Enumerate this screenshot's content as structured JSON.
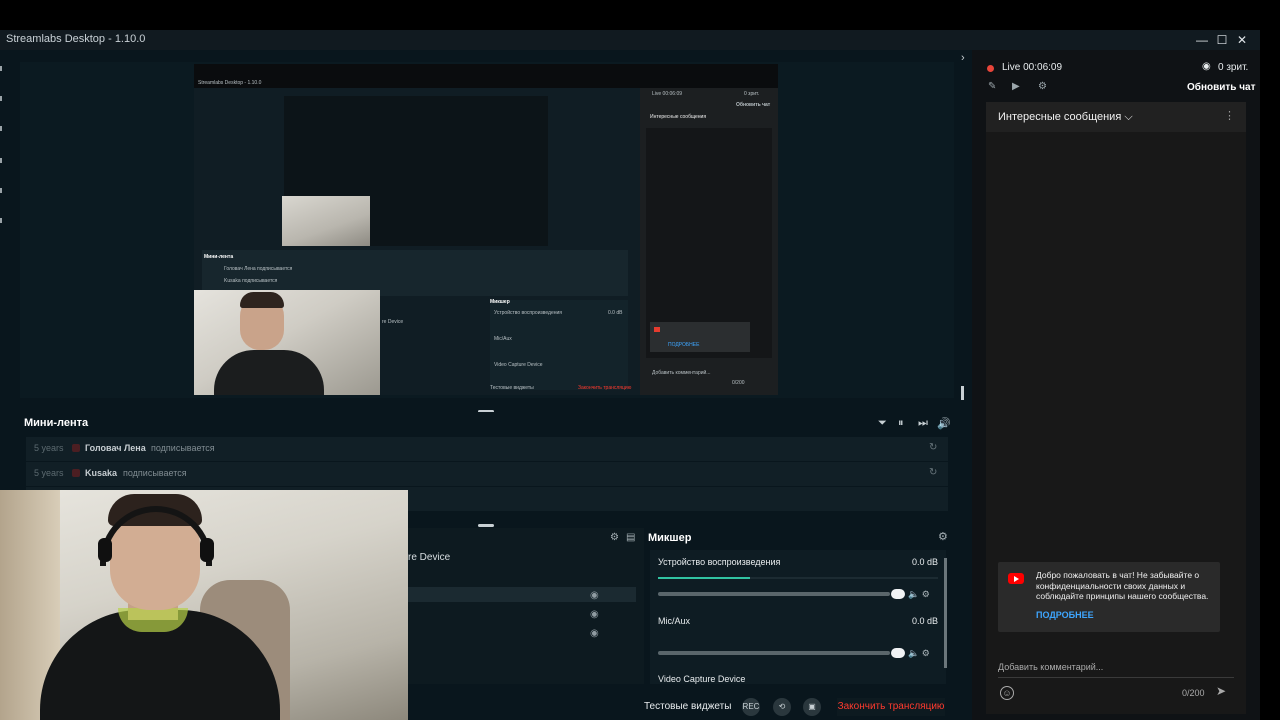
{
  "window": {
    "title": "Streamlabs Desktop - 1.10.0",
    "controls": [
      "—",
      "☐",
      "✕"
    ]
  },
  "preview": {
    "tiny_title": "Streamlabs Desktop - 1.10.0",
    "tiny_minifeed": "Мини-лента",
    "tiny_row1": "Головач Лена подписывается",
    "tiny_row2": "Kusaka подписывается",
    "tiny_mixer": "Микшер",
    "tiny_device": "Устройство воспроизведения",
    "tiny_db": "0.0 dB",
    "tiny_mic": "Mic/Aux",
    "tiny_videocap": "Video Capture Device",
    "tiny_widgets": "Тестовые виджеты",
    "tiny_end": "Закончить трансляцию",
    "tiny_chat_title": "Интересные сообщения",
    "tiny_live": "Live 00:06:09",
    "tiny_refresh": "Обновить чат",
    "tiny_add": "Добавить комментарий...",
    "tiny_count": "0/200",
    "tiny_more": "ПОДРОБНЕЕ",
    "tiny_viewers": "0 зрит.",
    "tiny_src": "re Device"
  },
  "minifeed": {
    "title": "Мини-лента",
    "controls": [
      "⏷",
      "⏸",
      "⏭",
      "🔊"
    ],
    "rows": [
      {
        "age": "5 years",
        "name": "Головач Лена",
        "action": "подписывается"
      },
      {
        "age": "5 years",
        "name": "Kusaka",
        "action": "подписывается"
      }
    ]
  },
  "sources": {
    "visible_name": "re Device",
    "icon_a": "⚙",
    "icon_b": "▤"
  },
  "mixer": {
    "title": "Микшер",
    "channels": [
      {
        "name": "Устройство воспроизведения",
        "db": "0.0 dB",
        "level": 0.33
      },
      {
        "name": "Mic/Aux",
        "db": "0.0 dB",
        "level": 0
      },
      {
        "name": "Video Capture Device",
        "db": "",
        "level": 0
      }
    ]
  },
  "footer": {
    "test_widgets": "Тестовые виджеты",
    "rec_label": "REC",
    "end_stream": "Закончить трансляцию"
  },
  "chat": {
    "live_time": "Live 00:06:09",
    "viewers": "0 зрит.",
    "refresh": "Обновить чат",
    "dropdown_title": "Интересные сообщения",
    "welcome": "Добро пожаловать в чат! Не забывайте о конфиденциальности своих данных и соблюдайте принципы нашего сообщества.",
    "learn_more": "ПОДРОБНЕЕ",
    "add_comment": "Добавить комментарий...",
    "char_count": "0/200"
  },
  "colors": {
    "accent_teal": "#31c3a2",
    "live_red": "#e8453a",
    "youtube_red": "#ff0000",
    "link_blue": "#3ea6ff"
  }
}
